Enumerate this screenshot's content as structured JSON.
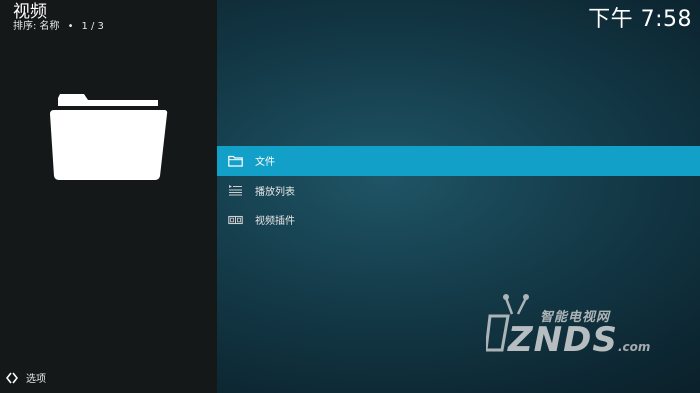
{
  "header": {
    "title": "视频",
    "sort_label": "排序: 名称",
    "separator": "•",
    "page_count": "1 / 3"
  },
  "clock": {
    "time": "下午 7:58"
  },
  "menu": {
    "items": [
      {
        "label": "文件",
        "icon": "folder-icon",
        "active": true
      },
      {
        "label": "播放列表",
        "icon": "playlist-icon",
        "active": false
      },
      {
        "label": "视频插件",
        "icon": "video-addon-icon",
        "active": false
      }
    ]
  },
  "footer": {
    "options_label": "选项",
    "icon": "options-arrow-icon"
  },
  "watermark": {
    "top_text": "智能电视网",
    "main_text": "ZNDS",
    "suffix": ".com"
  },
  "colors": {
    "accent": "#12a0c8",
    "left_panel": "#141819",
    "background": "#133846"
  }
}
